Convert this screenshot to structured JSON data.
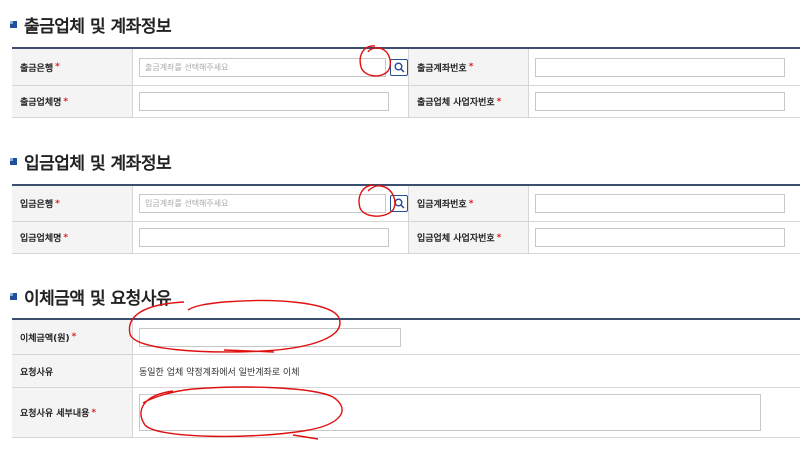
{
  "sections": {
    "withdraw": {
      "title": "출금업체 및 계좌정보",
      "bank_label": "출금은행",
      "bank_placeholder": "출금계좌를 선택해주세요",
      "account_label": "출금계좌번호",
      "company_label": "출금업체명",
      "biz_label": "출금업체 사업자번호"
    },
    "deposit": {
      "title": "입금업체 및 계좌정보",
      "bank_label": "입금은행",
      "bank_placeholder": "입금계좌를 선택해주세요",
      "account_label": "입금계좌번호",
      "company_label": "입금업체명",
      "biz_label": "입금업체 사업자번호"
    },
    "transfer": {
      "title": "이체금액 및 요청사유",
      "amount_label": "이체금액(원)",
      "reason_label": "요청사유",
      "reason_value": "동일한 업체 약정계좌에서 일반계좌로 이체",
      "detail_label": "요청사유 세부내용"
    }
  },
  "required_mark": "*",
  "icons": {
    "search": "search-icon"
  },
  "colors": {
    "accent": "#1f4e9a",
    "required": "#e02020",
    "annotation": "#e01010"
  }
}
